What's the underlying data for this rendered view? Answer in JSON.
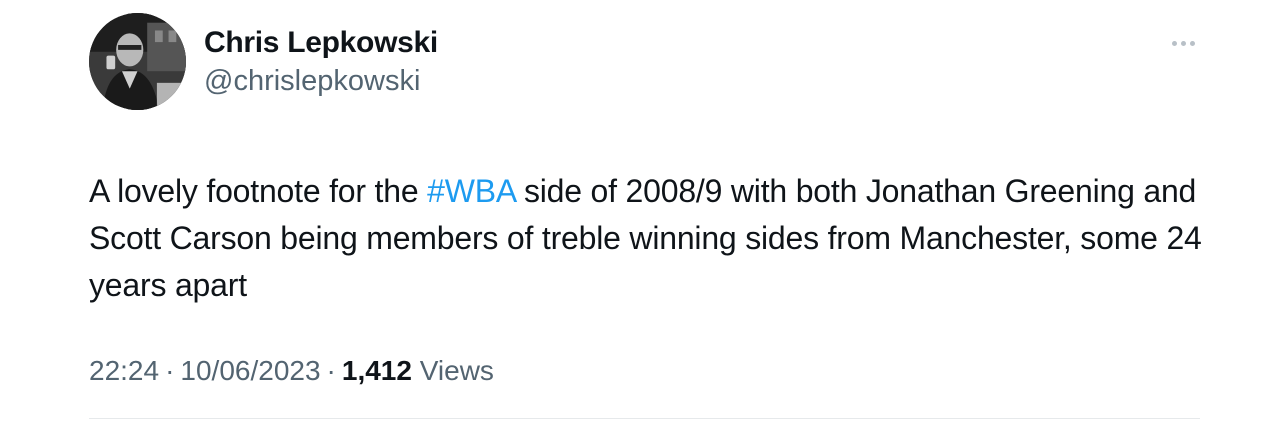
{
  "author": {
    "display_name": "Chris Lepkowski",
    "handle": "@chrislepkowski",
    "avatar_icon": "profile-photo"
  },
  "more_icon": "more-horizontal-icon",
  "tweet": {
    "text_before": "A lovely footnote for the ",
    "hashtag": "#WBA",
    "text_after": " side of 2008/9 with both Jonathan Greening and Scott Carson being members of treble winning sides from Manchester, some 24 years apart"
  },
  "meta": {
    "time": "22:24",
    "separator": "·",
    "date": "10/06/2023",
    "views_count": "1,412",
    "views_label": "Views"
  },
  "colors": {
    "text": "#0f1419",
    "secondary": "#536471",
    "link": "#1d9bf0"
  }
}
